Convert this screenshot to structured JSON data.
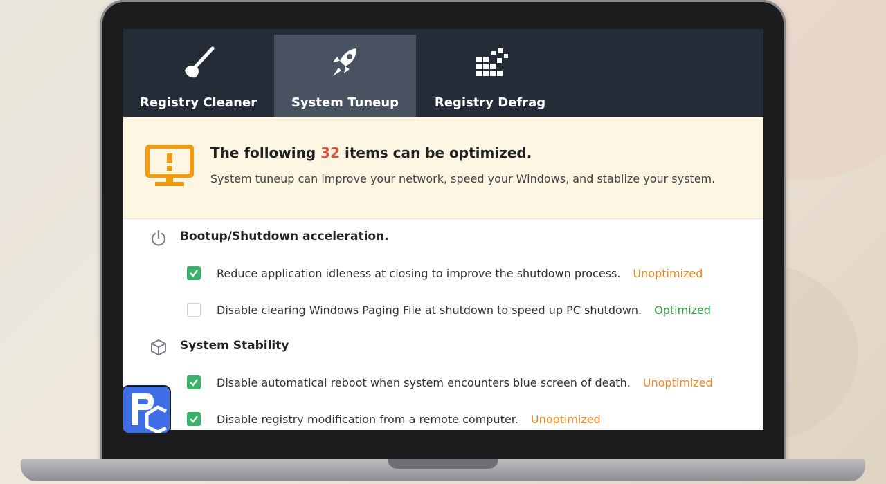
{
  "tabs": [
    {
      "label": "Registry Cleaner",
      "icon": "broom-icon",
      "active": false
    },
    {
      "label": "System Tuneup",
      "icon": "rocket-icon",
      "active": true
    },
    {
      "label": "Registry Defrag",
      "icon": "defrag-blocks-icon",
      "active": false
    }
  ],
  "banner": {
    "icon": "monitor-warning-icon",
    "headline_prefix": "The following",
    "count": "32",
    "headline_suffix": "items can be optimized.",
    "subtitle": "System tuneup can improve your network, speed your Windows, and stablize your system."
  },
  "sections": [
    {
      "title": "Bootup/Shutdown acceleration.",
      "icon": "power-icon",
      "items": [
        {
          "label": "Reduce application idleness at closing to improve the shutdown process.",
          "checked": true,
          "status": "Unoptimized"
        },
        {
          "label": "Disable clearing Windows Paging File at shutdown to speed up PC shutdown.",
          "checked": false,
          "status": "Optimized"
        }
      ]
    },
    {
      "title": "System Stability",
      "icon": "cube-icon",
      "items": [
        {
          "label": "Disable automatical reboot when system encounters blue screen of death.",
          "checked": true,
          "status": "Unoptimized"
        },
        {
          "label": "Disable registry modification from a remote computer.",
          "checked": true,
          "status": "Unoptimized"
        }
      ]
    }
  ],
  "colors": {
    "tabbar": "#232c37",
    "tab_active": "#485261",
    "banner_bg": "#fdf6e2",
    "accent_orange": "#f39c12",
    "count_red": "#e74c3c",
    "check_green": "#39b36a",
    "status_unoptimized": "#f08a24",
    "status_optimized": "#2e9a3e",
    "logo_blue": "#3d6ee6"
  },
  "watermark_logo": "PC"
}
